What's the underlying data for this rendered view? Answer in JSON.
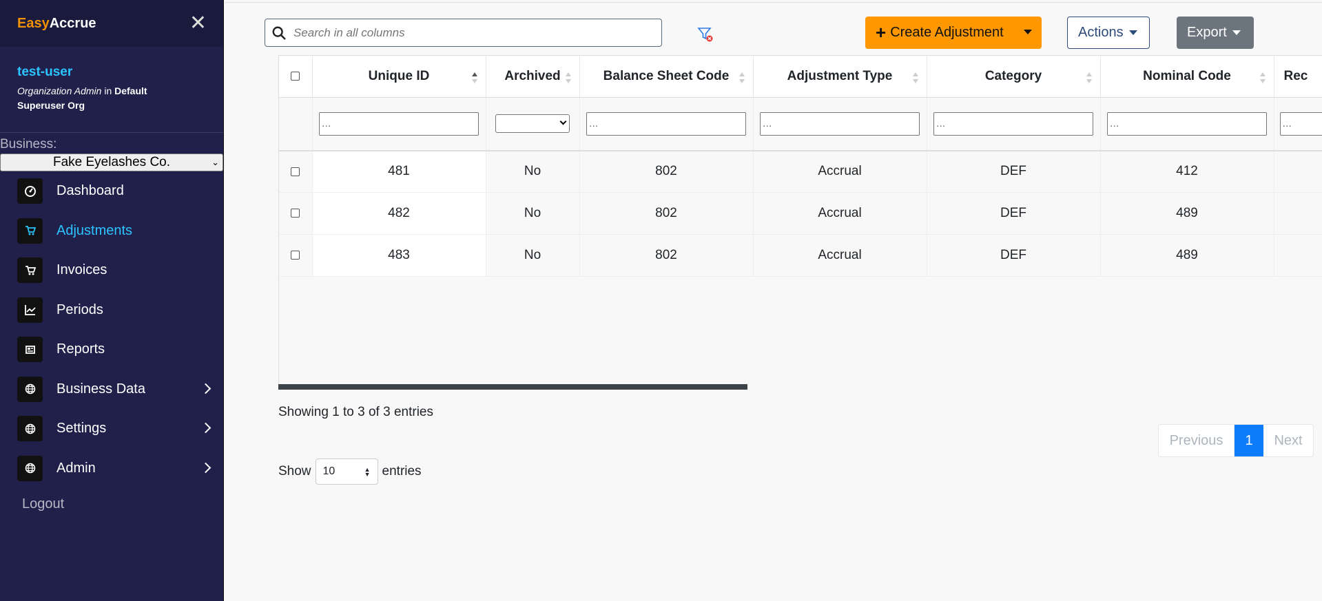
{
  "brand": {
    "easy": "Easy",
    "accrue": "Accrue"
  },
  "user": {
    "name": "test-user",
    "role": "Organization Admin",
    "in_word": "in",
    "org_line1": "Default",
    "org_line2": "Superuser Org"
  },
  "business": {
    "label": "Business:",
    "selected": "Fake Eyelashes Co."
  },
  "nav": [
    {
      "label": "Dashboard",
      "icon": "dashboard-icon"
    },
    {
      "label": "Adjustments",
      "icon": "cart-icon",
      "active": true
    },
    {
      "label": "Invoices",
      "icon": "cart-icon"
    },
    {
      "label": "Periods",
      "icon": "chart-line-icon"
    },
    {
      "label": "Reports",
      "icon": "newspaper-icon"
    },
    {
      "label": "Business Data",
      "icon": "globe-icon",
      "has_submenu": true
    },
    {
      "label": "Settings",
      "icon": "globe-icon",
      "has_submenu": true
    },
    {
      "label": "Admin",
      "icon": "globe-icon",
      "has_submenu": true
    }
  ],
  "logout_label": "Logout",
  "search": {
    "placeholder": "Search in all columns"
  },
  "toolbar": {
    "create_label": "Create Adjustment",
    "actions_label": "Actions",
    "export_label": "Export"
  },
  "table": {
    "columns": [
      "Unique ID",
      "Archived",
      "Balance Sheet Code",
      "Adjustment Type",
      "Category",
      "Nominal Code",
      "Rec"
    ],
    "filter_placeholder": "...",
    "rows": [
      [
        "481",
        "No",
        "802",
        "Accrual",
        "DEF",
        "412"
      ],
      [
        "482",
        "No",
        "802",
        "Accrual",
        "DEF",
        "489"
      ],
      [
        "483",
        "No",
        "802",
        "Accrual",
        "DEF",
        "489"
      ]
    ]
  },
  "footer": {
    "info": "Showing 1 to 3 of 3 entries",
    "show_label": "Show",
    "length_value": "10",
    "entries_label": "entries",
    "prev": "Previous",
    "page": "1",
    "next": "Next"
  },
  "colors": {
    "accent": "#2cc4ff",
    "brand_orange": "#f39200",
    "sidebar_bg": "#20204a",
    "create_btn": "#ff9800",
    "page_active": "#0d7dfd"
  }
}
